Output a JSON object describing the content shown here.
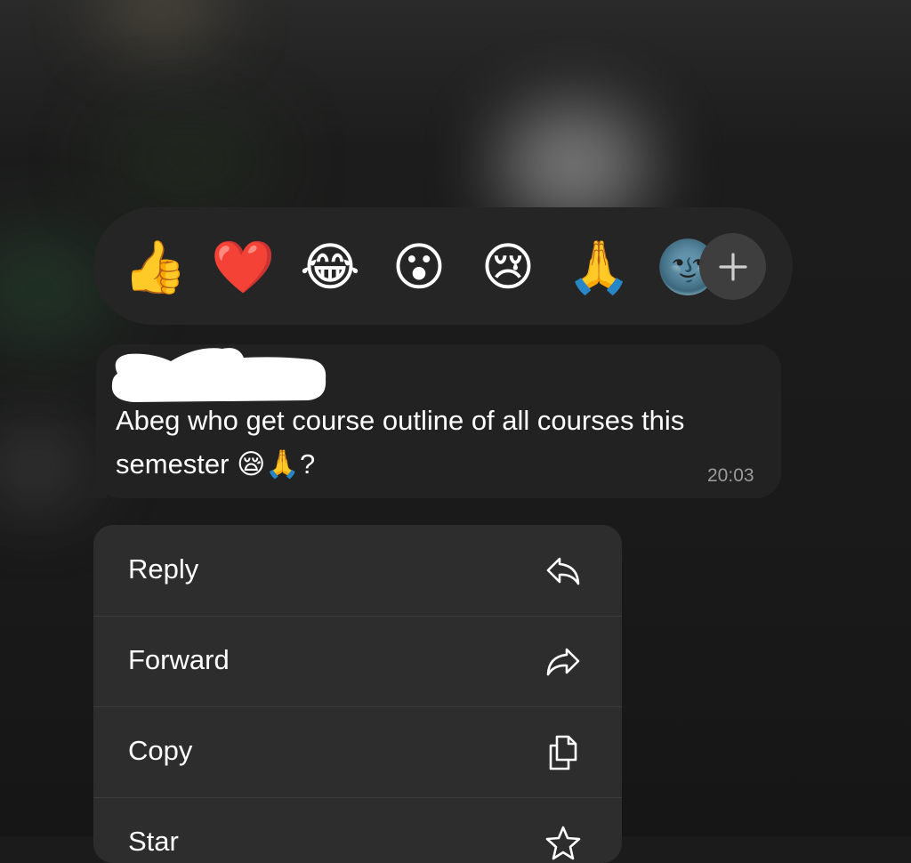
{
  "reactions": {
    "emojis": [
      {
        "name": "thumbs-up",
        "glyph": "👍"
      },
      {
        "name": "red-heart",
        "glyph": "❤️"
      },
      {
        "name": "tears-of-joy",
        "glyph": "😂"
      },
      {
        "name": "surprised",
        "glyph": "😮"
      },
      {
        "name": "crying",
        "glyph": "😢"
      },
      {
        "name": "folded-hands",
        "glyph": "🙏"
      },
      {
        "name": "new-moon-face",
        "glyph": "🌚"
      }
    ],
    "add_icon": "plus-icon"
  },
  "message": {
    "text": "Abeg who get course outline of all courses this semester 😪🙏?",
    "time": "20:03"
  },
  "menu": {
    "items": [
      {
        "label": "Reply",
        "icon": "reply-icon"
      },
      {
        "label": "Forward",
        "icon": "forward-icon"
      },
      {
        "label": "Copy",
        "icon": "copy-icon"
      },
      {
        "label": "Star",
        "icon": "star-icon"
      }
    ]
  },
  "colors": {
    "background": "#1b1b1b",
    "reaction_bar": "#252525",
    "bubble": "#222222",
    "menu": "#2d2d2d",
    "divider": "#3d3d3d",
    "timestamp": "#9b9b9b",
    "add_button": "#3e3e3e"
  }
}
